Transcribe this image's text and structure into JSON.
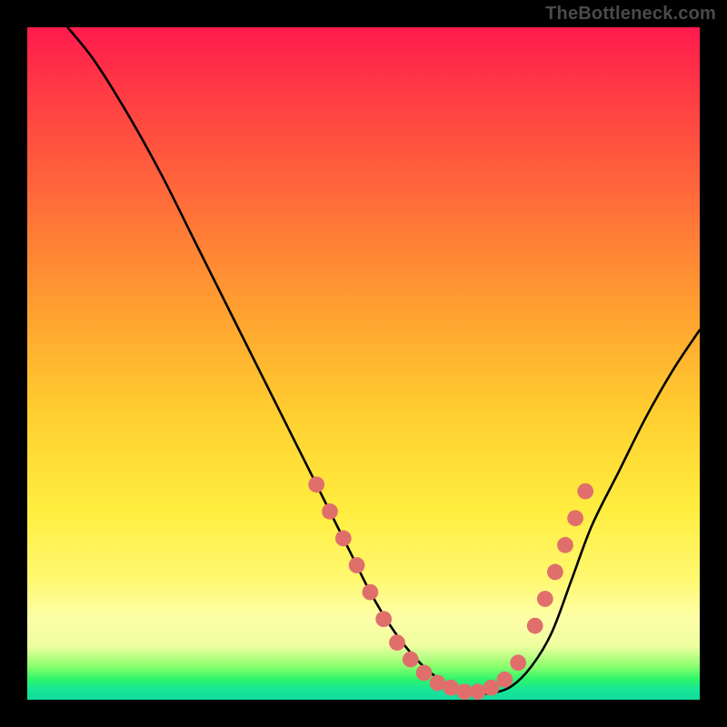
{
  "watermark": "TheBottleneck.com",
  "chart_data": {
    "type": "line",
    "title": "",
    "xlabel": "",
    "ylabel": "",
    "xlim": [
      0,
      100
    ],
    "ylim": [
      0,
      100
    ],
    "grid": false,
    "legend": false,
    "series": [
      {
        "name": "curve",
        "x": [
          6,
          10,
          15,
          20,
          25,
          30,
          35,
          40,
          45,
          48,
          51,
          54,
          57,
          60,
          63,
          66,
          69,
          72,
          75,
          78,
          81,
          84,
          88,
          92,
          96,
          100
        ],
        "y": [
          100,
          95,
          87,
          78,
          68,
          58,
          48,
          38,
          28,
          22,
          16,
          11,
          7,
          4,
          2,
          1,
          1,
          2,
          5,
          10,
          18,
          26,
          34,
          42,
          49,
          55
        ]
      }
    ],
    "markers": {
      "name": "highlighted-range",
      "color": "#e06f6c",
      "radius_pct": 1.2,
      "points": [
        {
          "x": 43,
          "y": 32
        },
        {
          "x": 45,
          "y": 28
        },
        {
          "x": 47,
          "y": 24
        },
        {
          "x": 49,
          "y": 20
        },
        {
          "x": 51,
          "y": 16
        },
        {
          "x": 53,
          "y": 12
        },
        {
          "x": 55,
          "y": 8.5
        },
        {
          "x": 57,
          "y": 6
        },
        {
          "x": 59,
          "y": 4
        },
        {
          "x": 61,
          "y": 2.5
        },
        {
          "x": 63,
          "y": 1.8
        },
        {
          "x": 65,
          "y": 1.2
        },
        {
          "x": 67,
          "y": 1.2
        },
        {
          "x": 69,
          "y": 1.8
        },
        {
          "x": 71,
          "y": 3
        },
        {
          "x": 73,
          "y": 5.5
        },
        {
          "x": 75.5,
          "y": 11
        },
        {
          "x": 77,
          "y": 15
        },
        {
          "x": 78.5,
          "y": 19
        },
        {
          "x": 80,
          "y": 23
        },
        {
          "x": 81.5,
          "y": 27
        },
        {
          "x": 83,
          "y": 31
        }
      ]
    },
    "colors": {
      "curve": "#000000",
      "marker": "#e06f6c",
      "background_top": "#ff1a4d",
      "background_mid": "#ffee40",
      "background_bottom": "#11db9e",
      "frame": "#000000"
    }
  }
}
